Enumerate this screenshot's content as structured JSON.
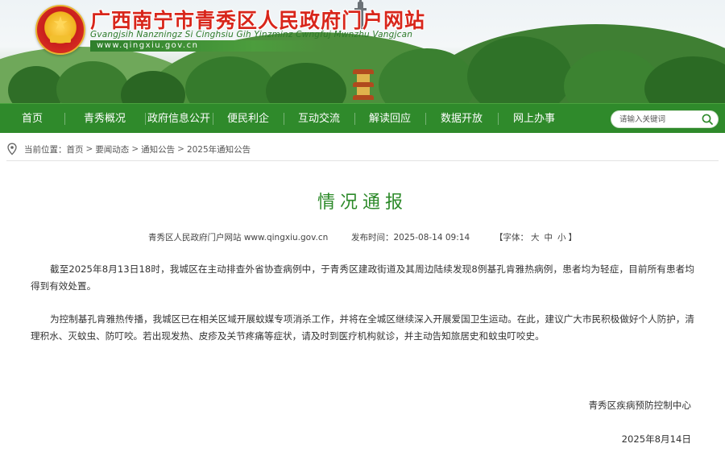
{
  "header": {
    "site_title": "广西南宁市青秀区人民政府门户网站",
    "site_subtitle": "Gvangjsih Nanzningz Si Cinghsiu Gih Yinzminz Cwngfuj Mwnzhu Vangjcan",
    "site_url": "www.qingxiu.gov.cn",
    "emblem_icon": "national-emblem-icon"
  },
  "nav": {
    "items": [
      {
        "label": "首页"
      },
      {
        "label": "青秀概况"
      },
      {
        "label": "政府信息公开"
      },
      {
        "label": "便民利企"
      },
      {
        "label": "互动交流"
      },
      {
        "label": "解读回应"
      },
      {
        "label": "数据开放"
      },
      {
        "label": "网上办事"
      }
    ],
    "search_placeholder": "请输入关键词",
    "color": "#2f8a2b"
  },
  "breadcrumb": {
    "prefix": "当前位置：",
    "items": [
      "首页",
      "要闻动态",
      "通知公告",
      "2025年通知公告"
    ],
    "separator": ">"
  },
  "article": {
    "title": "情况通报",
    "source": "青秀区人民政府门户网站 www.qingxiu.gov.cn",
    "publish_time_label": "发布时间：",
    "publish_time": "2025-08-14 09:14",
    "font_label_open": "【字体：",
    "font_large": "大",
    "font_medium": "中",
    "font_small": "小",
    "font_label_close": "】",
    "paragraphs": [
      "截至2025年8月13日18时，我城区在主动排查外省协查病例中，于青秀区建政街道及其周边陆续发现8例基孔肯雅热病例，患者均为轻症，目前所有患者均得到有效处置。",
      "为控制基孔肯雅热传播，我城区已在相关区域开展蚊媒专项消杀工作，并将在全城区继续深入开展爱国卫生运动。在此，建议广大市民积极做好个人防护，清理积水、灭蚊虫、防叮咬。若出现发热、皮疹及关节疼痛等症状，请及时到医疗机构就诊，并主动告知旅居史和蚊虫叮咬史。"
    ],
    "signature": "青秀区疾病预防控制中心",
    "date": "2025年8月14日",
    "title_color": "#2d8a2a"
  }
}
